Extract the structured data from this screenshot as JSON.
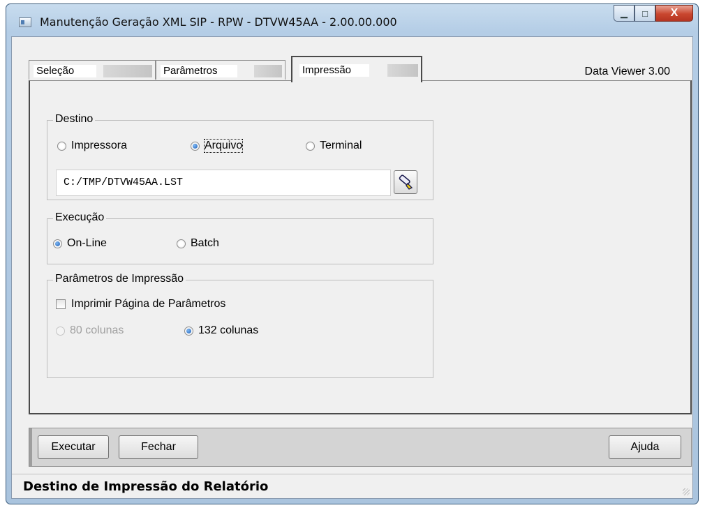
{
  "window": {
    "title": "Manutenção Geração XML SIP - RPW - DTVW45AA - 2.00.00.000",
    "caption_buttons": {
      "minimize": "▁",
      "maximize": "□",
      "close": "X"
    }
  },
  "tabs": [
    {
      "label": "Seleção",
      "active": false
    },
    {
      "label": "Parâmetros",
      "active": false
    },
    {
      "label": "Impressão",
      "active": true
    }
  ],
  "data_viewer": "Data Viewer 3.00",
  "destino": {
    "legend": "Destino",
    "options": [
      {
        "label": "Impressora",
        "selected": false
      },
      {
        "label": "Arquivo",
        "selected": true
      },
      {
        "label": "Terminal",
        "selected": false
      }
    ],
    "path": "C:/TMP/DTVW45AA.LST",
    "browse_icon": "flashlight-icon"
  },
  "execucao": {
    "legend": "Execução",
    "options": [
      {
        "label": "On-Line",
        "selected": true
      },
      {
        "label": "Batch",
        "selected": false
      }
    ]
  },
  "parametros_impressao": {
    "legend": "Parâmetros de Impressão",
    "checkbox_label": "Imprimir Página de Parâmetros",
    "checkbox_checked": false,
    "options": [
      {
        "label": "80 colunas",
        "selected": false,
        "disabled": true
      },
      {
        "label": "132 colunas",
        "selected": true,
        "disabled": false
      }
    ]
  },
  "buttons": {
    "execute": "Executar",
    "close": "Fechar",
    "help": "Ajuda"
  },
  "status": "Destino de Impressão do Relatório",
  "colors": {
    "accent_radio": "#1e5fb8",
    "close_button": "#c9462f",
    "window_frame": "#b4cde6"
  }
}
